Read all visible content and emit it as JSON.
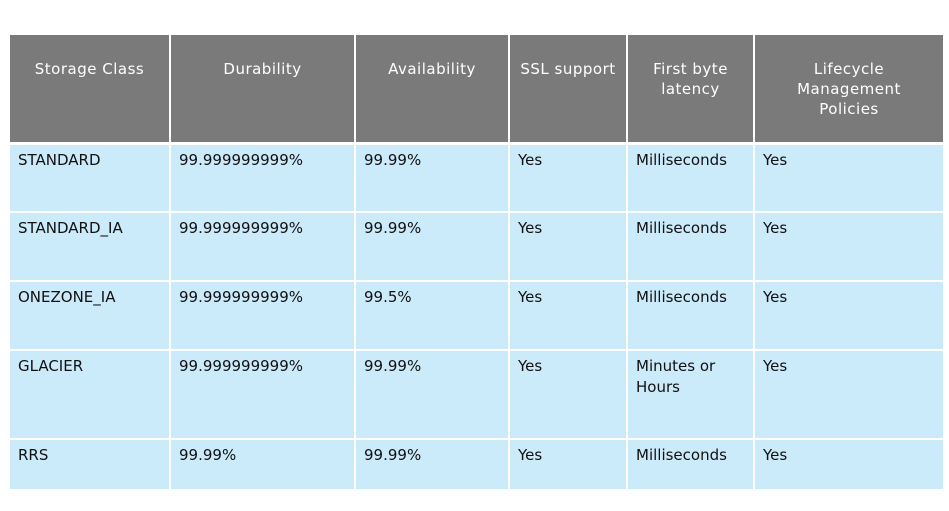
{
  "table": {
    "headers": [
      "Storage Class",
      "Durability",
      "Availability",
      "SSL support",
      "First byte latency",
      "Lifecycle Management Policies"
    ],
    "rows": [
      [
        "STANDARD",
        "99.999999999%",
        "99.99%",
        "Yes",
        "Milliseconds",
        "Yes"
      ],
      [
        "STANDARD_IA",
        "99.999999999%",
        "99.99%",
        "Yes",
        "Milliseconds",
        "Yes"
      ],
      [
        "ONEZONE_IA",
        "99.999999999%",
        "99.5%",
        "Yes",
        "Milliseconds",
        "Yes"
      ],
      [
        "GLACIER",
        "99.999999999%",
        "99.99%",
        "Yes",
        "Minutes or Hours",
        "Yes"
      ],
      [
        "RRS",
        "99.99%",
        "99.99%",
        "Yes",
        "Milliseconds",
        "Yes"
      ]
    ]
  },
  "colors": {
    "header_background": "#7a7a7a",
    "row_background": "#cbeafa",
    "grid_lines": "#ffffff"
  }
}
